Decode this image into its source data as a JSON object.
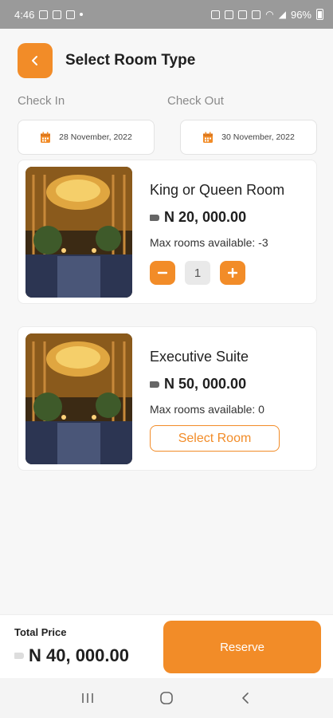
{
  "status_bar": {
    "time": "4:46",
    "battery": "96%"
  },
  "header": {
    "title": "Select Room Type"
  },
  "dates": {
    "check_in_label": "Check In",
    "check_out_label": "Check Out",
    "check_in_value": "28 November, 2022",
    "check_out_value": "30 November, 2022"
  },
  "rooms": [
    {
      "name": "King or Queen Room",
      "price": "N 20, 000.00",
      "availability": "Max rooms available: -3",
      "quantity": "1"
    },
    {
      "name": "Executive Suite",
      "price": "N 50, 000.00",
      "availability": "Max rooms available: 0",
      "select_label": "Select Room"
    }
  ],
  "footer": {
    "total_label": "Total Price",
    "total_value": "N 40, 000.00",
    "reserve_label": "Reserve"
  },
  "colors": {
    "accent": "#f28c28"
  }
}
